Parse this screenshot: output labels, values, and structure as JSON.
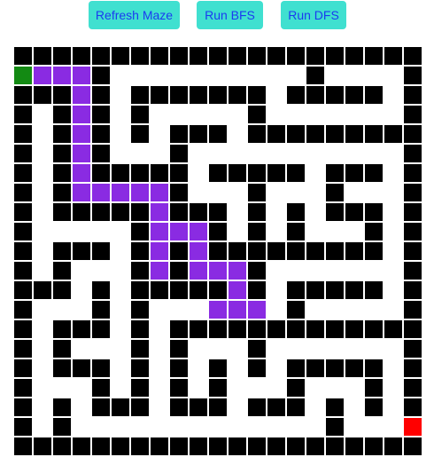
{
  "toolbar": {
    "refresh_label": "Refresh Maze",
    "bfs_label": "Run BFS",
    "dfs_label": "Run DFS"
  },
  "colors": {
    "button_bg": "#40e0d0",
    "button_text": "#1b3bf0",
    "wall": "#000000",
    "open": "#ffffff",
    "path": "#8a2be2",
    "start": "#138a13",
    "end": "#ff0000"
  },
  "maze": {
    "rows": 21,
    "cols": 21,
    "legend": {
      "#": "wall",
      ".": "open",
      "P": "path",
      "S": "start",
      "E": "end"
    },
    "grid": [
      "#####################",
      "SPPP#..........#....#",
      "###P#.#######.#####.#",
      "#.#P#.#.....#.......#",
      "#.#P#.#.###.#########",
      "#.#P#...#...........#",
      "#.#P#####.#####.###.#",
      "#.#PPPPP#...#...#...#",
      "#.#####P###.#.#.###.#",
      "#.....#PPP#.#.#...#.#",
      "#.###.#P#P#########.#",
      "#.#...#P#PPP#.......#",
      "###.#.#####P#.#####.#",
      "#...#.#...PPP.#.....#",
      "#.###.#.#############",
      "#.#...#.#...#.......#",
      "#.###.#.#.#.#.#####.#",
      "#...#.#.#.#...#...#.#",
      "#.#.###.###.###.#.#.#",
      "#.#.............#...E",
      "#####################"
    ]
  }
}
